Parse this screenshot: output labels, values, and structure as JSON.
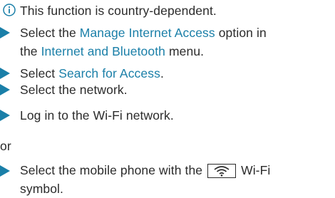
{
  "note": {
    "icon": "info-icon",
    "text": "This function is country-dependent."
  },
  "steps": [
    {
      "pre": "Select the ",
      "link1": "Manage Internet Access",
      "mid": " option in",
      "line2_pre": "the ",
      "link2": "Internet and Bluetooth",
      "post": " menu."
    },
    {
      "pre": "Select ",
      "link": "Search for Access",
      "post": "."
    },
    {
      "text": "Select the network."
    },
    {
      "text": "Log in to the Wi-Fi network."
    }
  ],
  "or_text": "or",
  "final_step": {
    "pre": "Select the mobile phone with the ",
    "icon": "wifi-icon",
    "post": " Wi-Fi",
    "line2": "symbol."
  },
  "colors": {
    "link": "#1a7fa8",
    "arrow": "#1a7fa8",
    "text": "#2b2b2b"
  }
}
